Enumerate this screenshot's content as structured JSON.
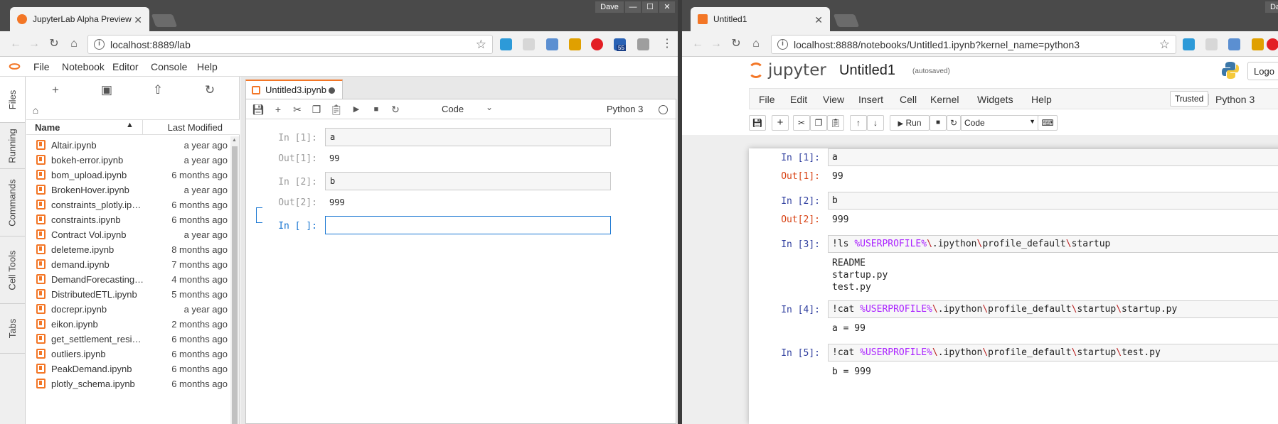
{
  "left": {
    "tab_title": "JupyterLab Alpha Preview",
    "user_badge": "Dave",
    "url": "localhost:8889/lab",
    "ext_badge": "55",
    "menu": [
      "File",
      "Notebook",
      "Editor",
      "Console",
      "Help"
    ],
    "side_tabs": [
      "Files",
      "Running",
      "Commands",
      "Cell Tools",
      "Tabs"
    ],
    "file_header": {
      "name": "Name",
      "modified": "Last Modified"
    },
    "files": [
      {
        "name": "Altair.ipynb",
        "modified": "a year ago"
      },
      {
        "name": "bokeh-error.ipynb",
        "modified": "a year ago"
      },
      {
        "name": "bom_upload.ipynb",
        "modified": "6 months ago"
      },
      {
        "name": "BrokenHover.ipynb",
        "modified": "a year ago"
      },
      {
        "name": "constraints_plotly.ip…",
        "modified": "6 months ago"
      },
      {
        "name": "constraints.ipynb",
        "modified": "6 months ago"
      },
      {
        "name": "Contract Vol.ipynb",
        "modified": "a year ago"
      },
      {
        "name": "deleteme.ipynb",
        "modified": "8 months ago"
      },
      {
        "name": "demand.ipynb",
        "modified": "7 months ago"
      },
      {
        "name": "DemandForecasting…",
        "modified": "4 months ago"
      },
      {
        "name": "DistributedETL.ipynb",
        "modified": "5 months ago"
      },
      {
        "name": "docrepr.ipynb",
        "modified": "a year ago"
      },
      {
        "name": "eikon.ipynb",
        "modified": "2 months ago"
      },
      {
        "name": "get_settlement_resi…",
        "modified": "6 months ago"
      },
      {
        "name": "outliers.ipynb",
        "modified": "6 months ago"
      },
      {
        "name": "PeakDemand.ipynb",
        "modified": "6 months ago"
      },
      {
        "name": "plotly_schema.ipynb",
        "modified": "6 months ago"
      }
    ],
    "doc_tab": "Untitled3.ipynb",
    "cell_type": "Code",
    "kernel": "Python 3",
    "cells": [
      {
        "in_prompt": "In [1]:",
        "code": "a",
        "out_prompt": "Out[1]:",
        "output": "99"
      },
      {
        "in_prompt": "In [2]:",
        "code": "b",
        "out_prompt": "Out[2]:",
        "output": "999"
      },
      {
        "in_prompt": "In [ ]:",
        "code": "",
        "out_prompt": "",
        "output": ""
      }
    ]
  },
  "right": {
    "tab_title": "Untitled1",
    "user_badge": "Da",
    "url": "localhost:8888/notebooks/Untitled1.ipynb?kernel_name=python3",
    "brand": "jupyter",
    "notebook_title": "Untitled1",
    "autosave": "(autosaved)",
    "logout": "Logo",
    "menu": [
      "File",
      "Edit",
      "View",
      "Insert",
      "Cell",
      "Kernel",
      "Widgets",
      "Help"
    ],
    "trusted": "Trusted",
    "kernel": "Python 3",
    "run_label": "Run",
    "cell_type": "Code",
    "cells": [
      {
        "in_prompt": "In [1]:",
        "code": "a",
        "out_prompt": "Out[1]:",
        "output": "99"
      },
      {
        "in_prompt": "In [2]:",
        "code": "b",
        "out_prompt": "Out[2]:",
        "output": "999"
      },
      {
        "in_prompt": "In [3]:",
        "code": "!ls %USERPROFILE%\\.ipython\\profile_default\\startup",
        "out_prompt": "",
        "output": "README\nstartup.py\ntest.py"
      },
      {
        "in_prompt": "In [4]:",
        "code": "!cat %USERPROFILE%\\.ipython\\profile_default\\startup\\startup.py",
        "out_prompt": "",
        "output": "a = 99"
      },
      {
        "in_prompt": "In [5]:",
        "code": "!cat %USERPROFILE%\\.ipython\\profile_default\\startup\\test.py",
        "out_prompt": "",
        "output": "b = 999"
      }
    ]
  },
  "colors": {
    "jupyter_orange": "#f37626",
    "in_prompt": "#303f9f",
    "out_prompt": "#d84315",
    "active_cell": "#1976d2"
  }
}
